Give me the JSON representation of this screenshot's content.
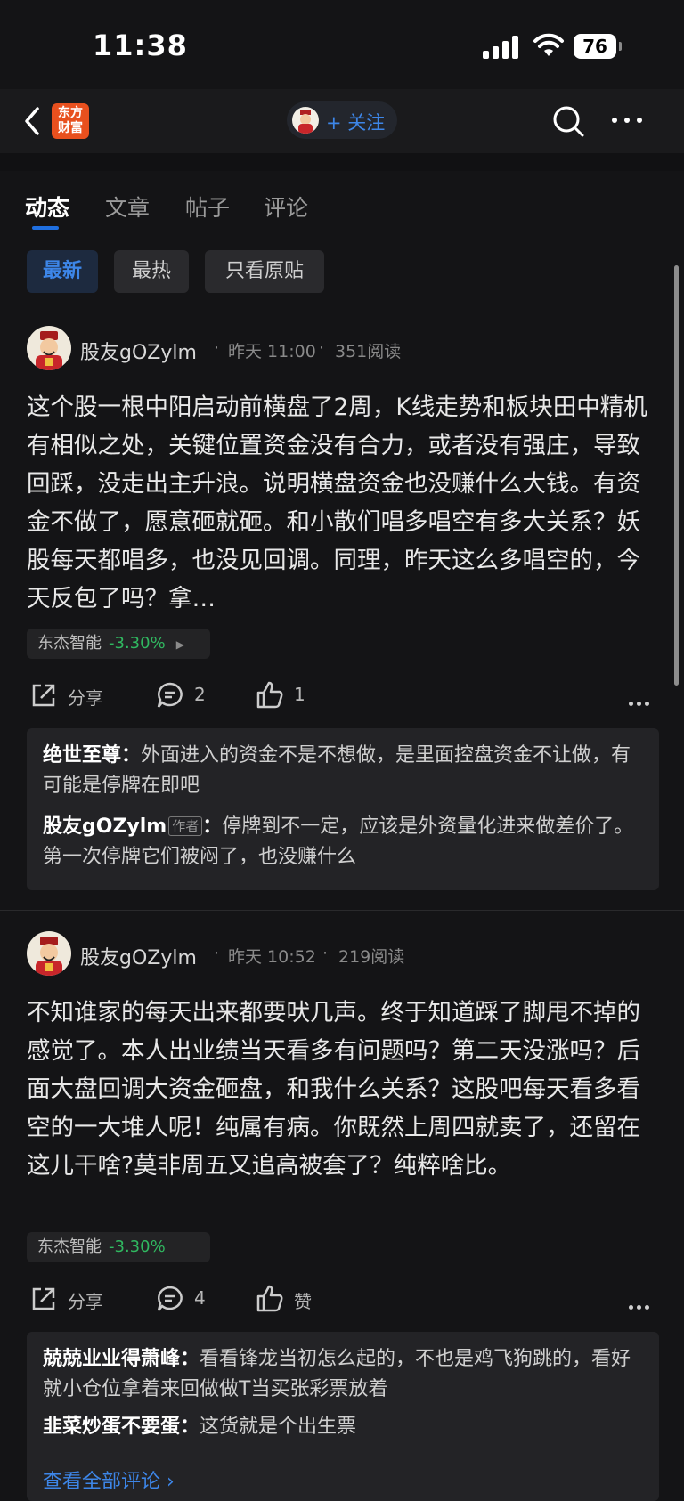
{
  "status": {
    "time": "11:38",
    "battery": "76"
  },
  "nav": {
    "logo_line1": "东方",
    "logo_line2": "财富",
    "follow_label": "+ 关注"
  },
  "tabs": [
    {
      "label": "动态",
      "active": true
    },
    {
      "label": "文章",
      "active": false
    },
    {
      "label": "帖子",
      "active": false
    },
    {
      "label": "评论",
      "active": false
    }
  ],
  "filters": [
    {
      "label": "最新",
      "active": true
    },
    {
      "label": "最热",
      "active": false
    },
    {
      "label": "只看原贴",
      "active": false
    }
  ],
  "posts": [
    {
      "author": "股友gOZylm",
      "time": "昨天 11:00",
      "reads": "351阅读",
      "body": "这个股一根中阳启动前横盘了2周，K线走势和板块田中精机有相似之处，关键位置资金没有合力，或者没有强庄，导致回踩，没走出主升浪。说明横盘资金也没赚什么大钱。有资金不做了，愿意砸就砸。和小散们唱多唱空有多大关系？妖股每天都唱多，也没见回调。同理，昨天这么多唱空的，今天反包了吗？拿…",
      "stock_name": "东杰智能",
      "stock_change": "-3.30%",
      "share_label": "分享",
      "comment_count": "2",
      "like_label": "1",
      "comments": [
        {
          "user": "绝世至尊",
          "sep": "：",
          "text": "外面进入的资金不是不想做，是里面控盘资金不让做，有可能是停牌在即吧"
        },
        {
          "user": "股友gOZylm",
          "badge": "作者",
          "sep": "：",
          "text": "停牌到不一定，应该是外资量化进来做差价了。第一次停牌它们被闷了，也没赚什么"
        }
      ]
    },
    {
      "author": "股友gOZylm",
      "time": "昨天 10:52",
      "reads": "219阅读",
      "body": "不知谁家的每天出来都要吠几声。终于知道踩了脚甩不掉的感觉了。本人出业绩当天看多有问题吗？第二天没涨吗？后面大盘回调大资金砸盘，和我什么关系？这股吧每天看多看空的一大堆人呢！纯属有病。你既然上周四就卖了，还留在这儿干啥?莫非周五又追高被套了？纯粹啥比。",
      "stock_name": "东杰智能",
      "stock_change": "-3.30%",
      "share_label": "分享",
      "comment_count": "4",
      "like_label": "赞",
      "comments": [
        {
          "user": "兢兢业业得萧峰",
          "sep": "：",
          "text": "看看锋龙当初怎么起的，不也是鸡飞狗跳的，看好就小仓位拿着来回做做T当买张彩票放着"
        },
        {
          "user": "韭菜炒蛋不要蛋",
          "sep": "：",
          "text": "这货就是个出生票"
        }
      ],
      "see_all": "查看全部评论 ›"
    }
  ],
  "meta_dot": "·",
  "colors": {
    "accent": "#3d86e8",
    "down": "#30b860",
    "bg": "#141416"
  }
}
